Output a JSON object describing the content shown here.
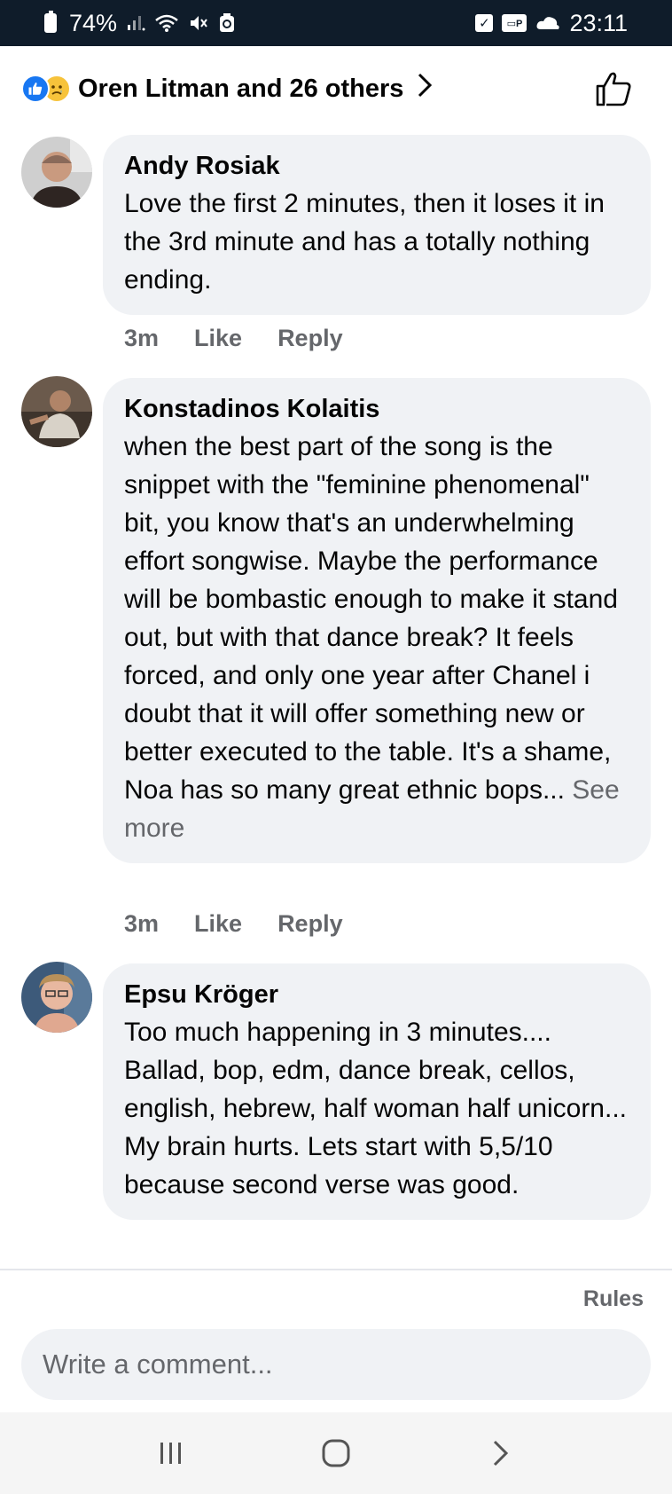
{
  "status_bar": {
    "battery": "74%",
    "time": "23:11"
  },
  "reactions": {
    "icons": [
      "like-reaction",
      "sad-reaction"
    ],
    "summary": "Oren Litman and 26 others"
  },
  "comments": [
    {
      "author": "Andy Rosiak",
      "text": "Love the first 2 minutes, then it loses it in the 3rd minute and has a totally nothing ending.",
      "time": "3m",
      "like_label": "Like",
      "reply_label": "Reply"
    },
    {
      "author": "Konstadinos Kolaitis",
      "text": "when the best part of the song is the snippet with the \"feminine phenomenal\" bit, you know that's an underwhelming effort songwise. Maybe the performance will be bombastic enough to make it stand out, but with that dance break? It feels forced, and only one year after Chanel i doubt that it will offer something new or better executed to the table. It's a shame, Noa has so many great ethnic bops...",
      "see_more": "See more",
      "time": "3m",
      "like_label": "Like",
      "reply_label": "Reply"
    },
    {
      "author": "Epsu Kröger",
      "text": "Too much happening in 3 minutes.... Ballad, bop, edm, dance break, cellos, english, hebrew, half woman half unicorn... My brain hurts. Lets start with 5,5/10 because second verse was good."
    }
  ],
  "composer": {
    "rules_label": "Rules",
    "placeholder": "Write a comment..."
  },
  "colors": {
    "status_bar_bg": "#0f1c2a",
    "bubble_bg": "#f0f2f5",
    "secondary_text": "#65676b",
    "like_blue": "#1877f2"
  }
}
